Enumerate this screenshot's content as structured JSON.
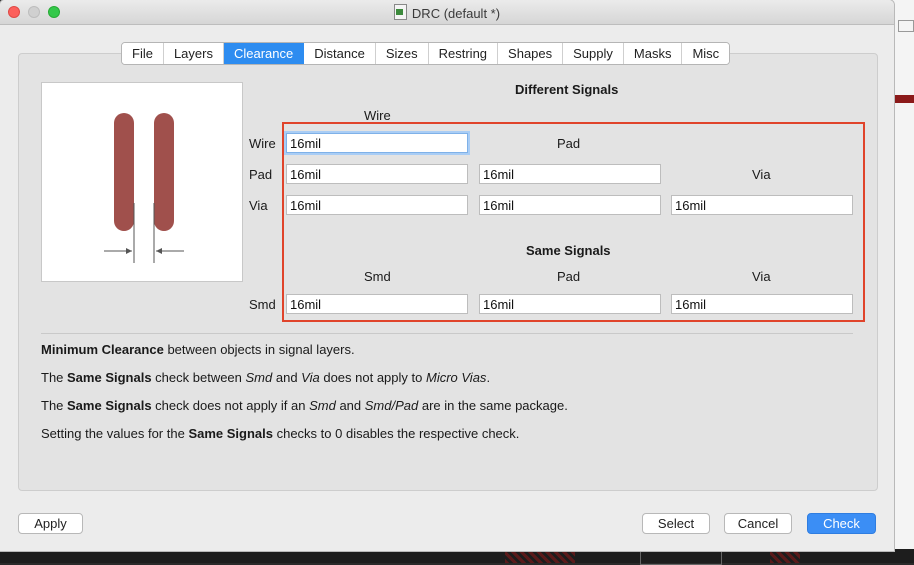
{
  "window": {
    "title": "DRC (default *)"
  },
  "tabs": [
    "File",
    "Layers",
    "Clearance",
    "Distance",
    "Sizes",
    "Restring",
    "Shapes",
    "Supply",
    "Masks",
    "Misc"
  ],
  "active_tab": "Clearance",
  "different_signals": {
    "heading": "Different Signals",
    "col_wire": "Wire",
    "col_pad": "Pad",
    "col_via": "Via",
    "row_wire": "Wire",
    "row_pad": "Pad",
    "row_via": "Via",
    "wire_wire": "16mil",
    "pad_wire": "16mil",
    "pad_pad": "16mil",
    "via_wire": "16mil",
    "via_pad": "16mil",
    "via_via": "16mil"
  },
  "same_signals": {
    "heading": "Same Signals",
    "col_smd": "Smd",
    "col_pad": "Pad",
    "col_via": "Via",
    "row_smd": "Smd",
    "smd_smd": "16mil",
    "smd_pad": "16mil",
    "smd_via": "16mil"
  },
  "notes": {
    "n1_b": "Minimum Clearance",
    "n1_t": " between objects in signal layers.",
    "n2_a": "The ",
    "n2_b": "Same Signals",
    "n2_c": " check between ",
    "n2_i1": "Smd",
    "n2_d": " and ",
    "n2_i2": "Via",
    "n2_e": " does not apply to ",
    "n2_i3": "Micro Vias",
    "n2_f": ".",
    "n3_a": "The ",
    "n3_b": "Same Signals",
    "n3_c": " check does not apply if an ",
    "n3_i1": "Smd",
    "n3_d": " and ",
    "n3_i2": "Smd/Pad",
    "n3_e": " are in the same package.",
    "n4_a": "Setting the values for the ",
    "n4_b": "Same Signals",
    "n4_c": " checks to 0 disables the respective check."
  },
  "buttons": {
    "apply": "Apply",
    "select": "Select",
    "cancel": "Cancel",
    "check": "Check"
  },
  "colors": {
    "accent": "#2d8cf0",
    "trace": "#a0504c",
    "highlight": "#e0442b"
  }
}
